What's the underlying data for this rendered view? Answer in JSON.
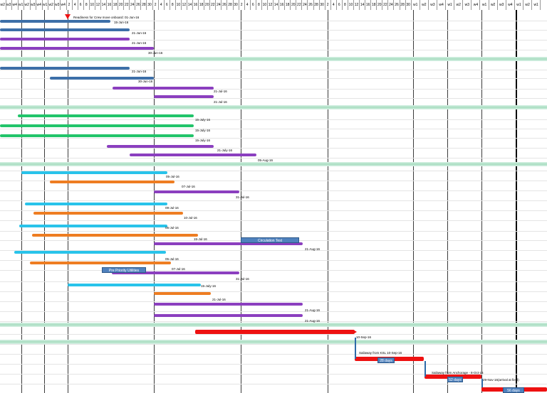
{
  "header_labels": [
    "w2",
    "w3",
    "w4",
    "w1",
    "w2",
    "w3",
    "w4",
    "w1",
    "w2",
    "w3",
    "w4",
    "2",
    "4",
    "6",
    "8",
    "10",
    "12",
    "14",
    "16",
    "18",
    "20",
    "22",
    "24",
    "26",
    "28",
    "30",
    "2",
    "4",
    "6",
    "8",
    "10",
    "12",
    "14",
    "16",
    "18",
    "20",
    "22",
    "24",
    "26",
    "28",
    "30",
    "2",
    "4",
    "6",
    "8",
    "10",
    "12",
    "14",
    "16",
    "18",
    "20",
    "22",
    "24",
    "26",
    "28",
    "30",
    "2",
    "4",
    "6",
    "8",
    "10",
    "12",
    "14",
    "16",
    "18",
    "20",
    "22",
    "24",
    "26",
    "28",
    "30",
    "w1",
    "w2",
    "w3",
    "w4",
    "w1",
    "w2",
    "w3",
    "w4",
    "w1",
    "w2",
    "w3",
    "w4",
    "w1",
    "w2",
    "w1"
  ],
  "annotations": [
    "Readiness for Crew move onboard: 01-Jun-16",
    "15-Jun-16",
    "21-Jun-16",
    "21-Jun-16",
    "30-Jun-16",
    "21-Jun-16",
    "30-Jun-16",
    "21-Jul-16",
    "21-Jul-16",
    "15-July-16",
    "15-July-16",
    "15-July-16",
    "21-July-16",
    "05-Aug-16",
    "05-Jul-16",
    "07-Jul-16",
    "31-Jul-16",
    "09-Jul-16",
    "10-Jul-16",
    "05-Jul-16",
    "15-Jul-16",
    "21-Aug-16",
    "05-Jul-16",
    "07-Jul-16",
    "31-Jul-16",
    "15-July-16",
    "21-Jul-16",
    "21-Aug-16",
    "21-Aug-16",
    "10-Sep-16",
    "Sailaway from KSL 10-Sep-16",
    "Sailaway from Anchorage - 8-Oct-16",
    "29-Nov-16(arrival at field)"
  ],
  "boxes": [
    "Circulation Test",
    "Pre Priority Utilities",
    "28 days",
    "52 days",
    "56 days"
  ],
  "colors": {
    "blue": "#3d6fa8",
    "green": "#22c46a",
    "purple": "#8b3fbf",
    "cyan": "#29c3ea",
    "orange": "#ee7d22",
    "red": "#ee1111",
    "separator": "#a7dcc0",
    "box": "#4f81bd"
  }
}
